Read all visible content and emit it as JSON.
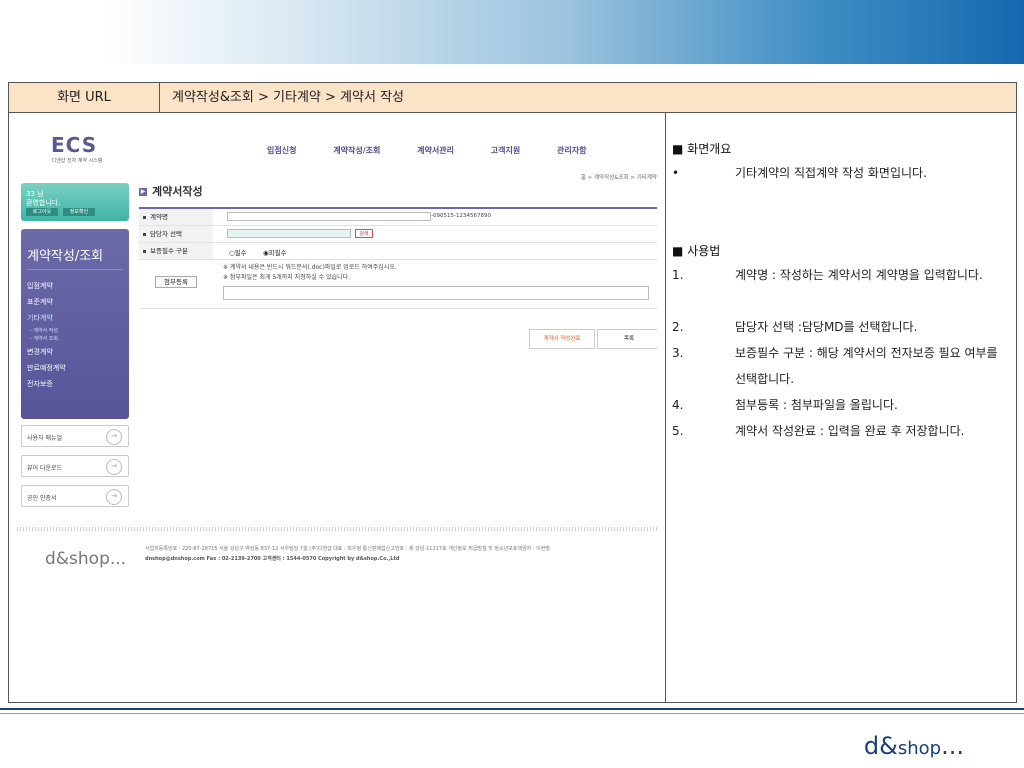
{
  "header": {
    "label": "화면 URL",
    "path": "계약작성&조회 > 기타계약 > 계약서 작성"
  },
  "mock": {
    "logo": "ECS",
    "logo_sub": "디앤샵 전자 계약 시스템",
    "nav": [
      "입점신청",
      "계약작성/조회",
      "계약서관리",
      "고객지원",
      "관리자함"
    ],
    "breadcrumb": "홈 > 계약작성&조회 > 기타계약",
    "welcome_name": "33 님",
    "welcome_msg": "환영합니다.",
    "logout_btn": "로그아웃",
    "info_btn": "정보확인",
    "menu_title": "계약작성/조회",
    "menu_items": [
      "입점계약",
      "표준계약",
      "기타계약",
      "변경계약",
      "만료예정계약",
      "전자보증"
    ],
    "submenu": [
      "- 계약서 작성",
      "- 계약서 조회"
    ],
    "side_links": [
      "사용자 매뉴얼",
      "뷰어 다운로드",
      "공인 인증서"
    ],
    "page_title": "계약서작성",
    "form": {
      "contract_name_label": "계약명",
      "contract_name_hint": "-090515-1234567890",
      "manager_label": "담당자 선택",
      "search_btn": "검색",
      "guarantee_label": "보증필수 구분",
      "opt_required": "필수",
      "opt_not_required": "피필수",
      "attach_btn": "첨부등록",
      "note1": "※ 계약서 내용은 반드시 워드문서(.doc)파일로 업로드 하여주십시오.",
      "note2": "※ 첨부파일은 최게 5개까지 지정하실 수 있습니다."
    },
    "btn_complete": "계약서 작성완료",
    "btn_list": "목록",
    "footer_logo": "d&shop...",
    "footer_line1": "사업자등록번호 : 220-87-28715  서울 강남구 역삼동 837-12 서우빌딩 7층 (주)디엔샵  대표 : 최우정 통신판매업신고번호 : 제 강남-11217호 개인정보 취급방침 및 청소년보호책임자 : 이현범",
    "footer_line2": "dnshop@dnshop.com Fax : 02-2139-2700 고객센터 : 1544-0570 Copyright by d&shop.Co.,Ltd"
  },
  "desc": {
    "overview_title": "■ 화면개요",
    "overview_bullet": "•",
    "overview_text": "기타계약의 직접계약 작성 화면입니다.",
    "usage_title": "■ 사용법",
    "steps": [
      {
        "num": "1.",
        "text": "계약명 : 작성하는 계약서의 계약명을 입력합니다."
      },
      {
        "num": "2.",
        "text": "담당자 선택 :담당MD를 선택합니다."
      },
      {
        "num": "3.",
        "text": "보증필수 구분 : 해당 계약서의 전자보증 필요 여부를 선택합니다."
      },
      {
        "num": "4.",
        "text": "첨부등록 : 첨부파일을 올립니다."
      },
      {
        "num": "5.",
        "text": "계약서 작성완료 : 입력을 완료 후 저장합니다."
      }
    ]
  },
  "brand": {
    "main": "d&",
    "tail": "shop",
    "dots": "..."
  }
}
